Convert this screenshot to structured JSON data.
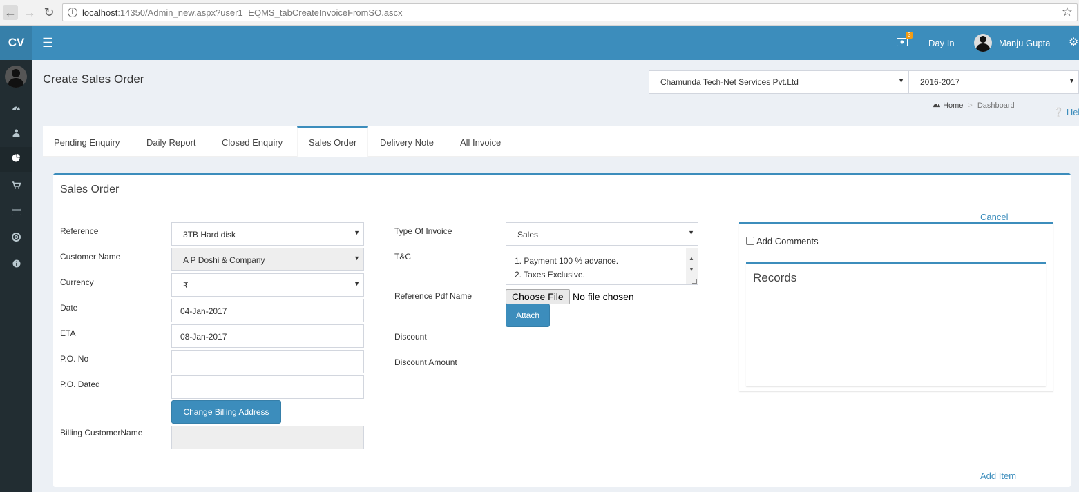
{
  "browser": {
    "url_host": "localhost",
    "url_rest": ":14350/Admin_new.aspx?user1=EQMS_tabCreateInvoiceFromSO.ascx"
  },
  "app": {
    "logo": "CV"
  },
  "header": {
    "message_count": "3",
    "day_in": "Day In",
    "user_name": "Manju Gupta"
  },
  "page": {
    "title": "Create Sales Order",
    "company": "Chamunda Tech-Net Services Pvt.Ltd",
    "year": "2016-2017",
    "breadcrumb": {
      "home": "Home",
      "current": "Dashboard"
    },
    "help": "Help"
  },
  "tabs": [
    {
      "label": "Pending Enquiry"
    },
    {
      "label": "Daily Report"
    },
    {
      "label": "Closed Enquiry"
    },
    {
      "label": "Sales Order"
    },
    {
      "label": "Delivery Note"
    },
    {
      "label": "All Invoice"
    }
  ],
  "active_tab": "Sales Order",
  "form": {
    "box_title": "Sales Order",
    "reference_label": "Reference",
    "reference_value": "3TB Hard disk",
    "customer_label": "Customer Name",
    "customer_value": "A P Doshi & Company",
    "currency_label": "Currency",
    "currency_value": "₹",
    "date_label": "Date",
    "date_value": "04-Jan-2017",
    "eta_label": "ETA",
    "eta_value": "08-Jan-2017",
    "po_no_label": "P.O. No",
    "po_no_value": "",
    "po_dated_label": "P.O. Dated",
    "po_dated_value": "",
    "change_billing_button": "Change Billing Address",
    "billing_customer_label": "Billing CustomerName",
    "billing_customer_value": "",
    "invoice_type_label": "Type Of Invoice",
    "invoice_type_value": "Sales",
    "tc_label": "T&C",
    "tc_line1": "1. Payment 100 % advance.",
    "tc_line2": "2. Taxes Exclusive.",
    "ref_pdf_label": "Reference Pdf Name",
    "choose_file_button": "Choose File",
    "no_file_text": "No file chosen",
    "attach_button": "Attach",
    "discount_label": "Discount",
    "discount_value": "",
    "discount_amount_label": "Discount Amount",
    "cancel_link": "Cancel",
    "add_comments_label": "Add Comments",
    "records_title": "Records",
    "add_item_link": "Add Item"
  }
}
